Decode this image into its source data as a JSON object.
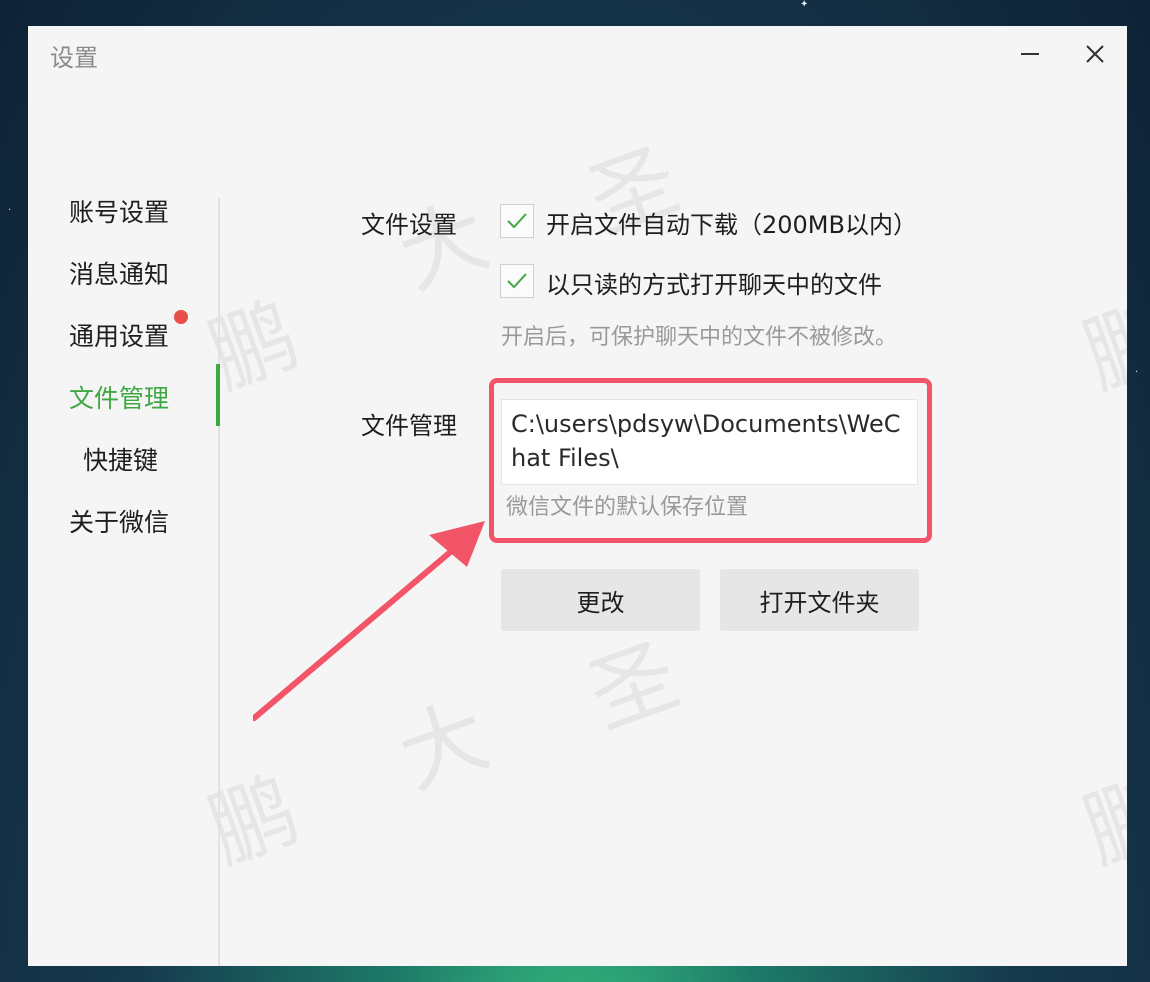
{
  "window": {
    "title": "设置"
  },
  "sidebar": {
    "items": [
      {
        "label": "账号设置"
      },
      {
        "label": "消息通知"
      },
      {
        "label": "通用设置",
        "has_badge": true
      },
      {
        "label": "文件管理",
        "active": true
      },
      {
        "label": "快捷键"
      },
      {
        "label": "关于微信"
      }
    ]
  },
  "file_settings": {
    "section_label": "文件设置",
    "auto_download": {
      "label": "开启文件自动下载（200MB以内）",
      "checked": true
    },
    "read_only": {
      "label": "以只读的方式打开聊天中的文件",
      "checked": true
    },
    "hint": "开启后，可保护聊天中的文件不被修改。"
  },
  "file_management": {
    "section_label": "文件管理",
    "path": "C:\\users\\pdsyw\\Documents\\WeChat Files\\",
    "hint": "微信文件的默认保存位置",
    "change_button": "更改",
    "open_folder_button": "打开文件夹"
  },
  "watermark": [
    "鹏",
    "大",
    "圣"
  ],
  "colors": {
    "accent": "#40a745",
    "badge": "#e9504a",
    "highlight": "#f25468",
    "window_bg": "#f5f5f5"
  }
}
